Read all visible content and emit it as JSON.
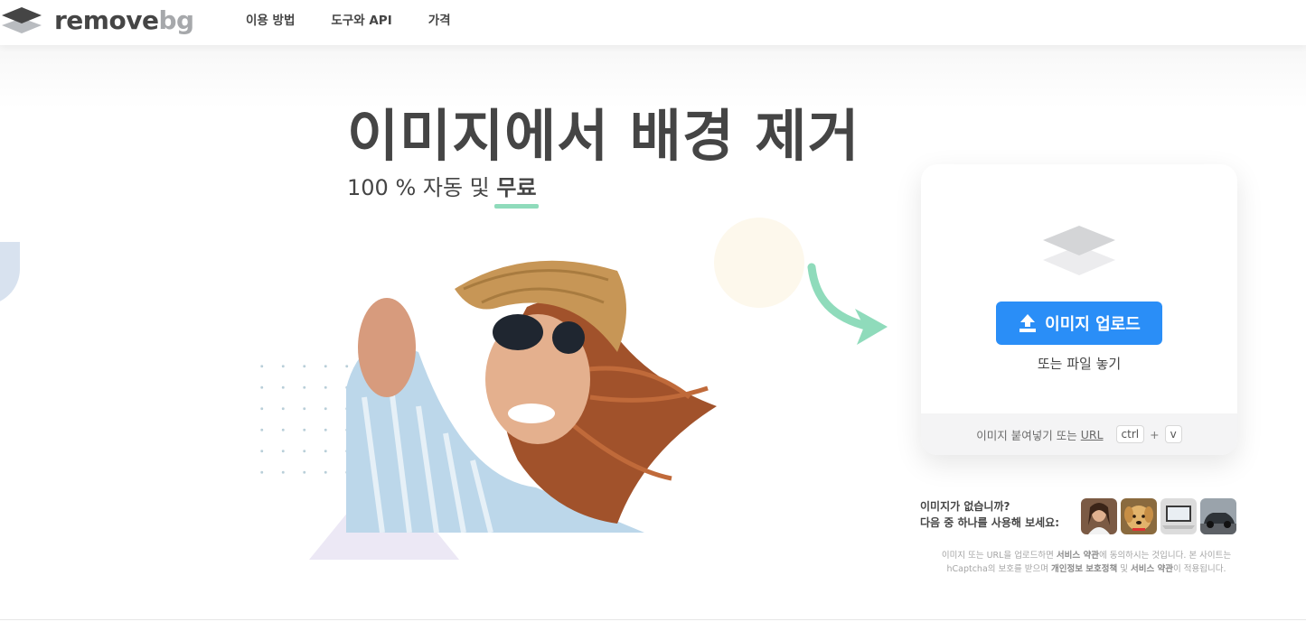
{
  "header": {
    "logo_main": "remove",
    "logo_accent": "bg",
    "nav": [
      "이용 방법",
      "도구와 API",
      "가격"
    ]
  },
  "hero": {
    "title": "이미지에서 배경 제거",
    "subtitle_prefix": "100 % 자동 및 ",
    "subtitle_highlight": "무료"
  },
  "upload": {
    "button_label": "이미지 업로드",
    "drop_text": "또는 파일 놓기",
    "paste_text": "이미지 붙여넣기 또는",
    "url_label": "URL",
    "kbd_ctrl": "ctrl",
    "kbd_plus": "+",
    "kbd_v": "v"
  },
  "samples": {
    "line1": "이미지가 없습니까?",
    "line2": "다음 중 하나를 사용해 보세요:",
    "thumbnails": [
      "woman-sample",
      "dog-sample",
      "laptop-sample",
      "car-sample"
    ]
  },
  "legal": {
    "part1": "이미지 또는 URL을 업로드하면 ",
    "terms1": "서비스 약관",
    "part2": "에 동의하시는 것입니다. 본 사이트는 hCaptcha의 보호를 받으며 ",
    "privacy": "개인정보 보호정책",
    "part3": " 및 ",
    "terms2": "서비스 약관",
    "part4": "이 적용됩니다."
  },
  "colors": {
    "accent_blue": "#2a8ef7",
    "highlight_green": "#8fdbbb",
    "text_dark": "#454545"
  }
}
